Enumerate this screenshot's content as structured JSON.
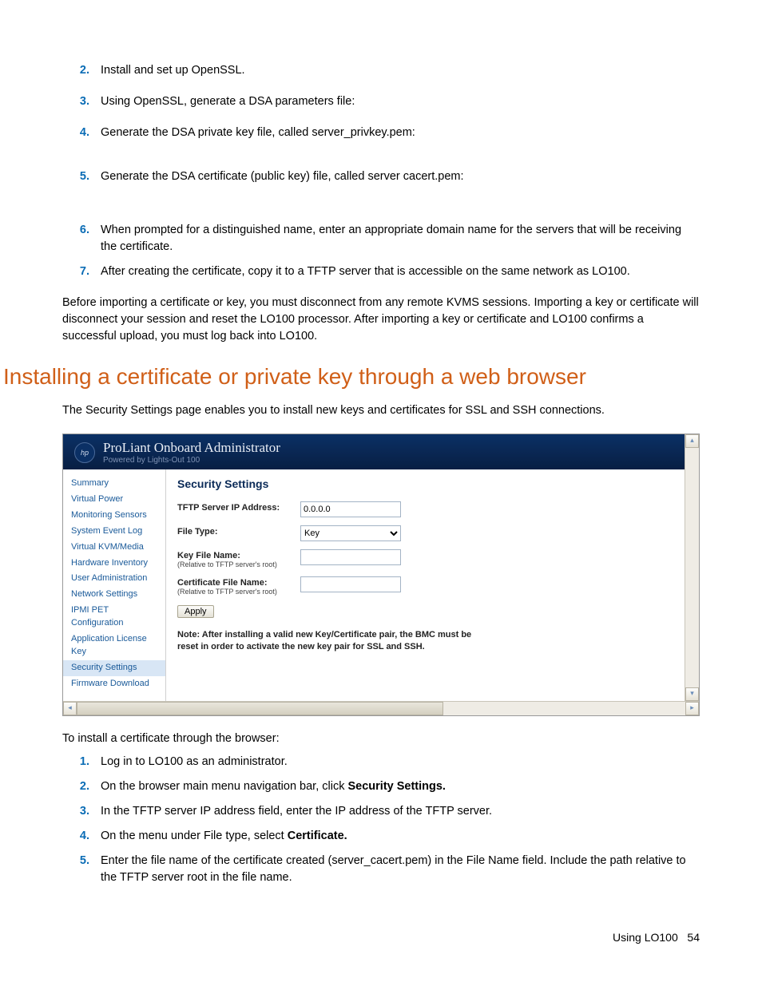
{
  "steps_top": [
    {
      "num": "2.",
      "text": "Install and set up OpenSSL."
    },
    {
      "num": "3.",
      "text": "Using OpenSSL, generate a DSA parameters file:"
    },
    {
      "num": "4.",
      "text": "Generate the DSA private key file, called server_privkey.pem:"
    },
    {
      "num": "5.",
      "text": "Generate the DSA certificate (public key) file, called server cacert.pem:"
    },
    {
      "num": "6.",
      "text": "When prompted for a distinguished name, enter an appropriate domain name for the servers that will be receiving the certificate."
    },
    {
      "num": "7.",
      "text": "After creating the certificate, copy it to a TFTP server that is accessible on the same network as LO100."
    }
  ],
  "para_before": "Before importing a certificate or key, you must disconnect from any remote KVMS sessions. Importing a key or certificate will disconnect your session and reset the LO100 processor. After importing a key or certificate and LO100 confirms a successful upload, you must log back into LO100.",
  "section_heading": "Installing a certificate or private key through a web browser",
  "intro_text": "The Security Settings page enables you to install new keys and certificates for SSL and SSH connections.",
  "app": {
    "logo_text": "hp",
    "title": "ProLiant Onboard Administrator",
    "subtitle": "Powered by Lights-Out 100",
    "sidebar": [
      {
        "label": "Summary",
        "selected": false
      },
      {
        "label": "Virtual Power",
        "selected": false
      },
      {
        "label": "Monitoring Sensors",
        "selected": false
      },
      {
        "label": "System Event Log",
        "selected": false
      },
      {
        "label": "Virtual KVM/Media",
        "selected": false
      },
      {
        "label": "Hardware Inventory",
        "selected": false
      },
      {
        "label": "User Administration",
        "selected": false
      },
      {
        "label": "Network Settings",
        "selected": false
      },
      {
        "label": "IPMI PET Configuration",
        "selected": false
      },
      {
        "label": "Application License Key",
        "selected": false
      },
      {
        "label": "Security Settings",
        "selected": true
      },
      {
        "label": "Firmware Download",
        "selected": false
      }
    ],
    "content": {
      "heading": "Security Settings",
      "tftp_label": "TFTP Server IP Address:",
      "tftp_value": "0.0.0.0",
      "filetype_label": "File Type:",
      "filetype_value": "Key",
      "keyfile_label": "Key File Name:",
      "keyfile_sub": "(Relative to TFTP server's root)",
      "keyfile_value": "",
      "certfile_label": "Certificate File Name:",
      "certfile_sub": "(Relative to TFTP server's root)",
      "certfile_value": "",
      "apply_label": "Apply",
      "note": "Note: After installing a valid new Key/Certificate pair, the BMC must be reset in order to activate the new key pair for SSL and SSH."
    }
  },
  "post_text": "To install a certificate through the browser:",
  "steps_bottom": [
    {
      "num": "1.",
      "text_before": "Log in to LO100 as an administrator.",
      "bold": "",
      "text_after": ""
    },
    {
      "num": "2.",
      "text_before": "On the browser main menu navigation bar, click ",
      "bold": "Security Settings.",
      "text_after": ""
    },
    {
      "num": "3.",
      "text_before": "In the TFTP server IP address field, enter the IP address of the TFTP server.",
      "bold": "",
      "text_after": ""
    },
    {
      "num": "4.",
      "text_before": "On the menu under File type, select ",
      "bold": "Certificate.",
      "text_after": ""
    },
    {
      "num": "5.",
      "text_before": "Enter the file name of the certificate created (server_cacert.pem) in the File Name field. Include the path relative to the TFTP server root in the file name.",
      "bold": "",
      "text_after": ""
    }
  ],
  "footer": {
    "section": "Using LO100",
    "page": "54"
  }
}
